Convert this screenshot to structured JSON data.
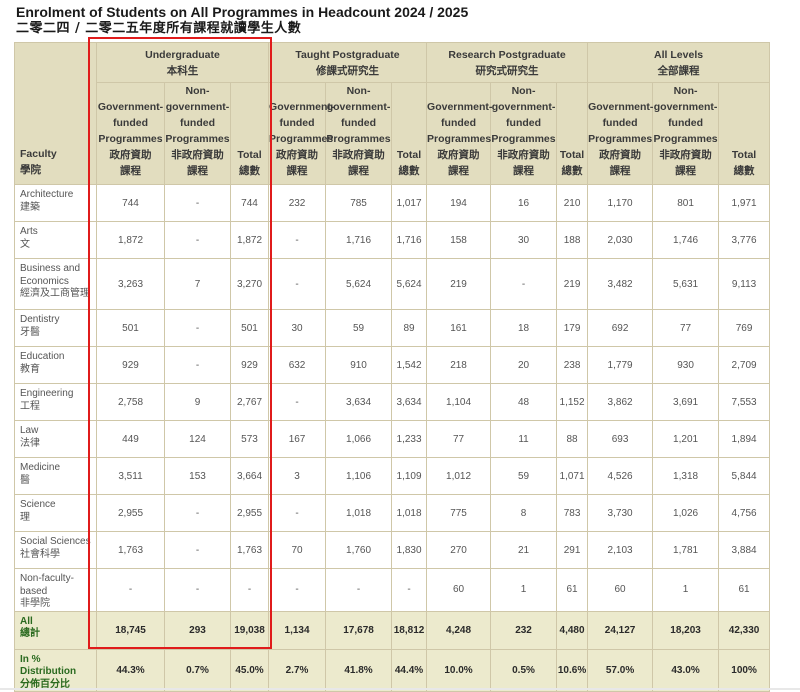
{
  "title_en": "Enrolment of Students on All Programmes in Headcount 2024 / 2025",
  "title_zh": "二零二四 / 二零二五年度所有課程就讀學生人數",
  "header": {
    "faculty_en": "Faculty",
    "faculty_zh": "學院",
    "groups": [
      {
        "en": "Undergraduate",
        "zh": "本科生"
      },
      {
        "en": "Taught Postgraduate",
        "zh": "修課式研究生"
      },
      {
        "en": "Research Postgraduate",
        "zh": "研究式研究生"
      },
      {
        "en": "All Levels",
        "zh": "全部課程"
      }
    ],
    "sub": [
      {
        "l1": "Government-",
        "l2": "funded",
        "l3": "Programmes",
        "zh1": "政府資助",
        "zh2": "課程"
      },
      {
        "l1": "Non-",
        "l2": "government-",
        "l3": "funded",
        "l4": "Programmes",
        "zh1": "非政府資助",
        "zh2": "課程"
      },
      {
        "l1": "Total",
        "zh1": "總數"
      }
    ]
  },
  "rows": [
    {
      "en": "Architecture",
      "zh": "建築",
      "v": [
        "744",
        "-",
        "744",
        "232",
        "785",
        "1,017",
        "194",
        "16",
        "210",
        "1,170",
        "801",
        "1,971"
      ]
    },
    {
      "en": "Arts",
      "zh": "文",
      "v": [
        "1,872",
        "-",
        "1,872",
        "-",
        "1,716",
        "1,716",
        "158",
        "30",
        "188",
        "2,030",
        "1,746",
        "3,776"
      ]
    },
    {
      "en": "Business and Economics",
      "zh": "經濟及工商管理",
      "v": [
        "3,263",
        "7",
        "3,270",
        "-",
        "5,624",
        "5,624",
        "219",
        "-",
        "219",
        "3,482",
        "5,631",
        "9,113"
      ]
    },
    {
      "en": "Dentistry",
      "zh": "牙醫",
      "v": [
        "501",
        "-",
        "501",
        "30",
        "59",
        "89",
        "161",
        "18",
        "179",
        "692",
        "77",
        "769"
      ]
    },
    {
      "en": "Education",
      "zh": "教育",
      "v": [
        "929",
        "-",
        "929",
        "632",
        "910",
        "1,542",
        "218",
        "20",
        "238",
        "1,779",
        "930",
        "2,709"
      ]
    },
    {
      "en": "Engineering",
      "zh": "工程",
      "v": [
        "2,758",
        "9",
        "2,767",
        "-",
        "3,634",
        "3,634",
        "1,104",
        "48",
        "1,152",
        "3,862",
        "3,691",
        "7,553"
      ]
    },
    {
      "en": "Law",
      "zh": "法律",
      "v": [
        "449",
        "124",
        "573",
        "167",
        "1,066",
        "1,233",
        "77",
        "11",
        "88",
        "693",
        "1,201",
        "1,894"
      ]
    },
    {
      "en": "Medicine",
      "zh": "醫",
      "v": [
        "3,511",
        "153",
        "3,664",
        "3",
        "1,106",
        "1,109",
        "1,012",
        "59",
        "1,071",
        "4,526",
        "1,318",
        "5,844"
      ]
    },
    {
      "en": "Science",
      "zh": "理",
      "v": [
        "2,955",
        "-",
        "2,955",
        "-",
        "1,018",
        "1,018",
        "775",
        "8",
        "783",
        "3,730",
        "1,026",
        "4,756"
      ]
    },
    {
      "en": "Social Sciences",
      "zh": "社會科學",
      "v": [
        "1,763",
        "-",
        "1,763",
        "70",
        "1,760",
        "1,830",
        "270",
        "21",
        "291",
        "2,103",
        "1,781",
        "3,884"
      ]
    },
    {
      "en": "Non-faculty-based",
      "zh": "非學院",
      "v": [
        "-",
        "-",
        "-",
        "-",
        "-",
        "-",
        "60",
        "1",
        "61",
        "60",
        "1",
        "61"
      ]
    }
  ],
  "total": {
    "en": "All",
    "zh": "總計",
    "v": [
      "18,745",
      "293",
      "19,038",
      "1,134",
      "17,678",
      "18,812",
      "4,248",
      "232",
      "4,480",
      "24,127",
      "18,203",
      "42,330"
    ]
  },
  "pct": {
    "en": "In % Distribution",
    "zh": "分佈百分比",
    "v": [
      "44.3%",
      "0.7%",
      "45.0%",
      "2.7%",
      "41.8%",
      "44.4%",
      "10.0%",
      "0.5%",
      "10.6%",
      "57.0%",
      "43.0%",
      "100%"
    ]
  },
  "colors": {
    "header_bg": "#e2ddbf",
    "border": "#cfc7a8",
    "highlight": "#e01b1b",
    "total_label": "#2a6a1f",
    "total_bg": "#eceacd"
  }
}
